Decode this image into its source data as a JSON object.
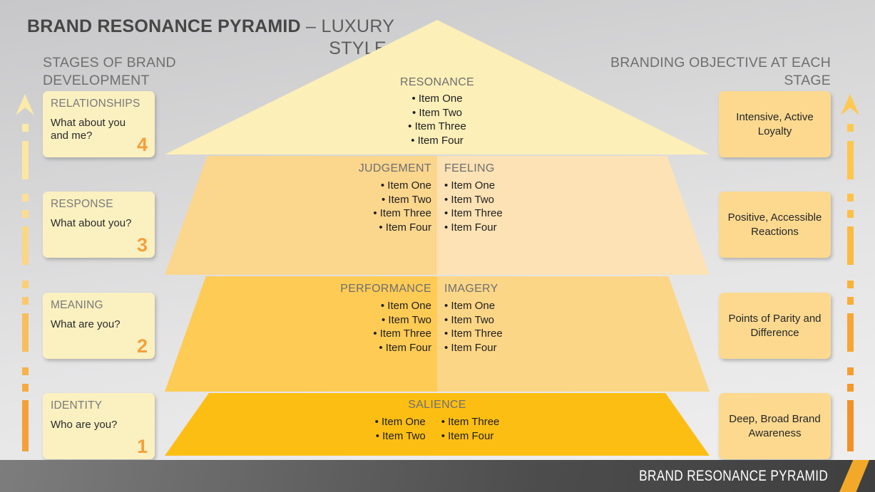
{
  "title": {
    "strong": "BRAND RESONANCE PYRAMID",
    "light": " – LUXURY",
    "line2": "STYLE"
  },
  "headings": {
    "left": "STAGES OF BRAND DEVELOPMENT",
    "right": "BRANDING OBJECTIVE AT EACH STAGE"
  },
  "colors": {
    "tier_resonance": "#fcefb8",
    "tier_judgement": "#fbd68d",
    "tier_feeling": "#fce2b4",
    "tier_performance": "#fecb55",
    "tier_imagery": "#fcd687",
    "tier_salience": "#fdbe14",
    "card_left": "#fbf0c0",
    "card_right": "#fcd98f",
    "number_accent": "#f2a03c",
    "footer_bar": "#4c4c4c",
    "footer_accent": "#f2a92a",
    "heading_gray": "#6f6f6f"
  },
  "stages": [
    {
      "title": "RELATIONSHIPS",
      "question": "What about you and me?",
      "number": "4"
    },
    {
      "title": "RESPONSE",
      "question": "What about you?",
      "number": "3"
    },
    {
      "title": "MEANING",
      "question": "What are you?",
      "number": "2"
    },
    {
      "title": "IDENTITY",
      "question": "Who are you?",
      "number": "1"
    }
  ],
  "objectives": [
    {
      "text": "Intensive, Active Loyalty"
    },
    {
      "text": "Positive, Accessible Reactions"
    },
    {
      "text": "Points of Parity and Difference"
    },
    {
      "text": "Deep, Broad Brand Awareness"
    }
  ],
  "pyramid": {
    "tier1": {
      "label": "RESONANCE",
      "items": [
        "• Item One",
        "• Item Two",
        "• Item Three",
        "• Item Four"
      ]
    },
    "tier2": {
      "left": {
        "label": "JUDGEMENT",
        "items": [
          "• Item One",
          "• Item Two",
          "• Item Three",
          "• Item Four"
        ]
      },
      "right": {
        "label": "FEELING",
        "items": [
          "• Item One",
          "• Item Two",
          "• Item Three",
          "• Item Four"
        ]
      }
    },
    "tier3": {
      "left": {
        "label": "PERFORMANCE",
        "items": [
          "• Item One",
          "• Item Two",
          "• Item Three",
          "• Item Four"
        ]
      },
      "right": {
        "label": "IMAGERY",
        "items": [
          "• Item One",
          "• Item Two",
          "• Item Three",
          "• Item Four"
        ]
      }
    },
    "tier4": {
      "label": "SALIENCE",
      "col_a": [
        "• Item One",
        "• Item Two"
      ],
      "col_b": [
        "• Item Three",
        "• Item Four"
      ]
    }
  },
  "arrows": {
    "left_icon": "up-arrow-icon",
    "right_icon": "up-arrow-icon"
  },
  "footer": {
    "label": "BRAND RESONANCE PYRAMID"
  }
}
